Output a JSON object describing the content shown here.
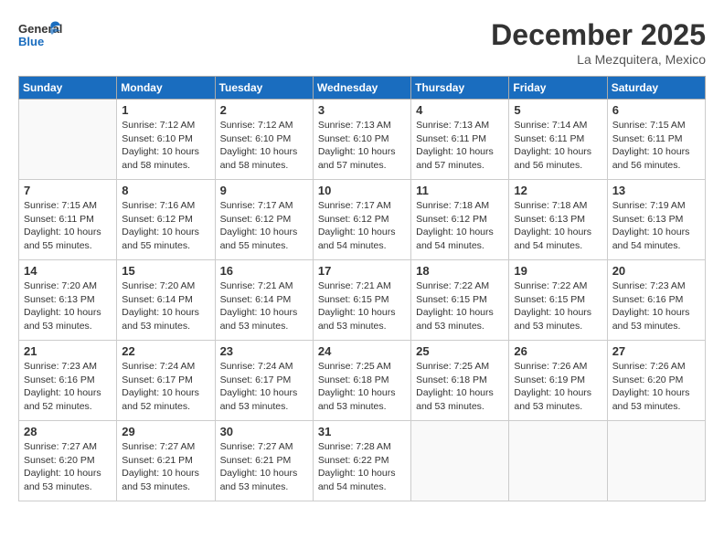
{
  "header": {
    "logo_general": "General",
    "logo_blue": "Blue",
    "month": "December 2025",
    "location": "La Mezquitera, Mexico"
  },
  "weekdays": [
    "Sunday",
    "Monday",
    "Tuesday",
    "Wednesday",
    "Thursday",
    "Friday",
    "Saturday"
  ],
  "weeks": [
    [
      {
        "day": "",
        "info": ""
      },
      {
        "day": "1",
        "info": "Sunrise: 7:12 AM\nSunset: 6:10 PM\nDaylight: 10 hours\nand 58 minutes."
      },
      {
        "day": "2",
        "info": "Sunrise: 7:12 AM\nSunset: 6:10 PM\nDaylight: 10 hours\nand 58 minutes."
      },
      {
        "day": "3",
        "info": "Sunrise: 7:13 AM\nSunset: 6:10 PM\nDaylight: 10 hours\nand 57 minutes."
      },
      {
        "day": "4",
        "info": "Sunrise: 7:13 AM\nSunset: 6:11 PM\nDaylight: 10 hours\nand 57 minutes."
      },
      {
        "day": "5",
        "info": "Sunrise: 7:14 AM\nSunset: 6:11 PM\nDaylight: 10 hours\nand 56 minutes."
      },
      {
        "day": "6",
        "info": "Sunrise: 7:15 AM\nSunset: 6:11 PM\nDaylight: 10 hours\nand 56 minutes."
      }
    ],
    [
      {
        "day": "7",
        "info": "Sunrise: 7:15 AM\nSunset: 6:11 PM\nDaylight: 10 hours\nand 55 minutes."
      },
      {
        "day": "8",
        "info": "Sunrise: 7:16 AM\nSunset: 6:12 PM\nDaylight: 10 hours\nand 55 minutes."
      },
      {
        "day": "9",
        "info": "Sunrise: 7:17 AM\nSunset: 6:12 PM\nDaylight: 10 hours\nand 55 minutes."
      },
      {
        "day": "10",
        "info": "Sunrise: 7:17 AM\nSunset: 6:12 PM\nDaylight: 10 hours\nand 54 minutes."
      },
      {
        "day": "11",
        "info": "Sunrise: 7:18 AM\nSunset: 6:12 PM\nDaylight: 10 hours\nand 54 minutes."
      },
      {
        "day": "12",
        "info": "Sunrise: 7:18 AM\nSunset: 6:13 PM\nDaylight: 10 hours\nand 54 minutes."
      },
      {
        "day": "13",
        "info": "Sunrise: 7:19 AM\nSunset: 6:13 PM\nDaylight: 10 hours\nand 54 minutes."
      }
    ],
    [
      {
        "day": "14",
        "info": "Sunrise: 7:20 AM\nSunset: 6:13 PM\nDaylight: 10 hours\nand 53 minutes."
      },
      {
        "day": "15",
        "info": "Sunrise: 7:20 AM\nSunset: 6:14 PM\nDaylight: 10 hours\nand 53 minutes."
      },
      {
        "day": "16",
        "info": "Sunrise: 7:21 AM\nSunset: 6:14 PM\nDaylight: 10 hours\nand 53 minutes."
      },
      {
        "day": "17",
        "info": "Sunrise: 7:21 AM\nSunset: 6:15 PM\nDaylight: 10 hours\nand 53 minutes."
      },
      {
        "day": "18",
        "info": "Sunrise: 7:22 AM\nSunset: 6:15 PM\nDaylight: 10 hours\nand 53 minutes."
      },
      {
        "day": "19",
        "info": "Sunrise: 7:22 AM\nSunset: 6:15 PM\nDaylight: 10 hours\nand 53 minutes."
      },
      {
        "day": "20",
        "info": "Sunrise: 7:23 AM\nSunset: 6:16 PM\nDaylight: 10 hours\nand 53 minutes."
      }
    ],
    [
      {
        "day": "21",
        "info": "Sunrise: 7:23 AM\nSunset: 6:16 PM\nDaylight: 10 hours\nand 52 minutes."
      },
      {
        "day": "22",
        "info": "Sunrise: 7:24 AM\nSunset: 6:17 PM\nDaylight: 10 hours\nand 52 minutes."
      },
      {
        "day": "23",
        "info": "Sunrise: 7:24 AM\nSunset: 6:17 PM\nDaylight: 10 hours\nand 53 minutes."
      },
      {
        "day": "24",
        "info": "Sunrise: 7:25 AM\nSunset: 6:18 PM\nDaylight: 10 hours\nand 53 minutes."
      },
      {
        "day": "25",
        "info": "Sunrise: 7:25 AM\nSunset: 6:18 PM\nDaylight: 10 hours\nand 53 minutes."
      },
      {
        "day": "26",
        "info": "Sunrise: 7:26 AM\nSunset: 6:19 PM\nDaylight: 10 hours\nand 53 minutes."
      },
      {
        "day": "27",
        "info": "Sunrise: 7:26 AM\nSunset: 6:20 PM\nDaylight: 10 hours\nand 53 minutes."
      }
    ],
    [
      {
        "day": "28",
        "info": "Sunrise: 7:27 AM\nSunset: 6:20 PM\nDaylight: 10 hours\nand 53 minutes."
      },
      {
        "day": "29",
        "info": "Sunrise: 7:27 AM\nSunset: 6:21 PM\nDaylight: 10 hours\nand 53 minutes."
      },
      {
        "day": "30",
        "info": "Sunrise: 7:27 AM\nSunset: 6:21 PM\nDaylight: 10 hours\nand 53 minutes."
      },
      {
        "day": "31",
        "info": "Sunrise: 7:28 AM\nSunset: 6:22 PM\nDaylight: 10 hours\nand 54 minutes."
      },
      {
        "day": "",
        "info": ""
      },
      {
        "day": "",
        "info": ""
      },
      {
        "day": "",
        "info": ""
      }
    ]
  ]
}
